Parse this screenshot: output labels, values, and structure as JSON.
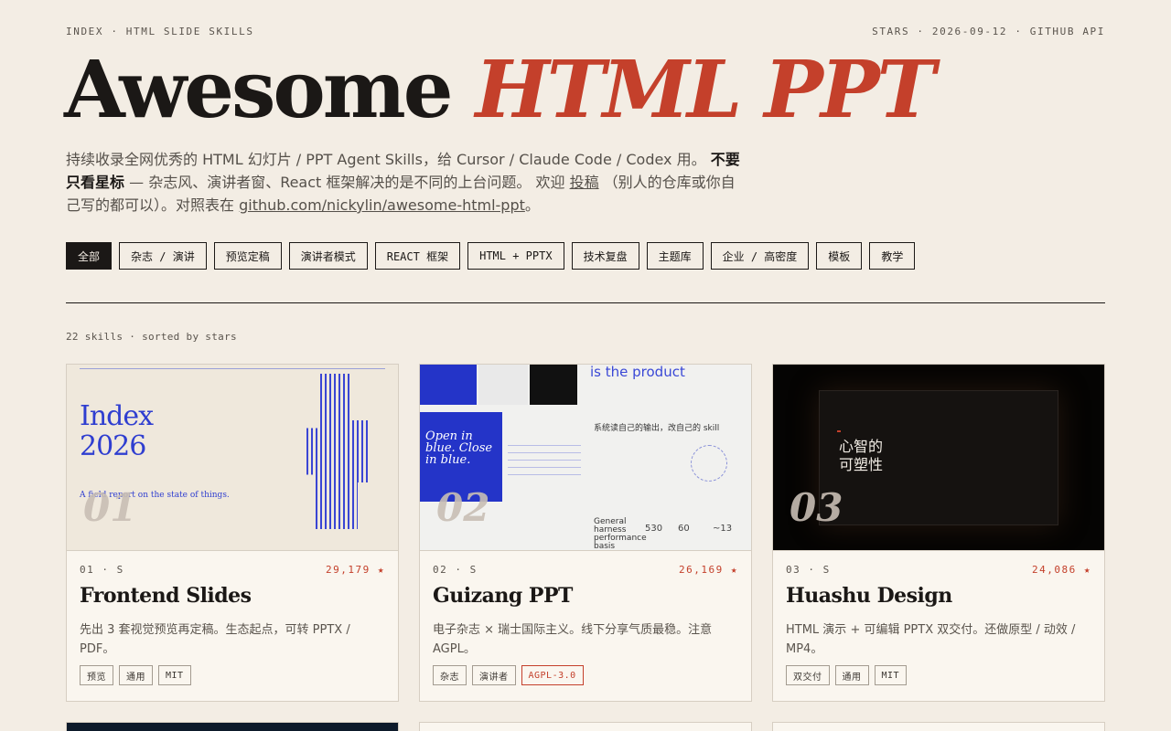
{
  "header": {
    "breadcrumb": "INDEX · HTML SLIDE SKILLS",
    "meta": "STARS · 2026-09-12 · GITHUB API",
    "title_main": "Awesome",
    "title_accent": "HTML PPT"
  },
  "intro": {
    "part1": "持续收录全网优秀的 HTML 幻灯片 / PPT Agent Skills，给 Cursor / Claude Code / Codex 用。",
    "bold": "不要只看星标",
    "part2": " — 杂志风、演讲者窗、React 框架解决的是不同的上台问题。 欢迎 ",
    "submit_link": "投稿",
    "part3": " （别人的仓库或你自己写的都可以）。对照表在 ",
    "repo_link": "github.com/nickylin/awesome-html-ppt",
    "part4": "。"
  },
  "filters": [
    {
      "label": "全部",
      "active": true
    },
    {
      "label": "杂志 / 演讲"
    },
    {
      "label": "预览定稿"
    },
    {
      "label": "演讲者模式"
    },
    {
      "label": "REACT 框架"
    },
    {
      "label": "HTML + PPTX"
    },
    {
      "label": "技术复盘"
    },
    {
      "label": "主题库"
    },
    {
      "label": "企业 / 高密度"
    },
    {
      "label": "模板"
    },
    {
      "label": "教学"
    }
  ],
  "count_text": "22 skills · sorted by stars",
  "cards": [
    {
      "num": "01",
      "meta": "01 · S",
      "stars": "29,179 ★",
      "title": "Frontend Slides",
      "desc": "先出 3 套视觉预览再定稿。生态起点，可转 PPTX / PDF。",
      "tags": [
        {
          "label": "预览"
        },
        {
          "label": "通用"
        },
        {
          "label": "MIT"
        }
      ],
      "thumb": {
        "heading_line1": "Index",
        "heading_line2": "2026",
        "subtitle": "A field report on the state of things."
      }
    },
    {
      "num": "02",
      "meta": "02 · S",
      "stars": "26,169 ★",
      "title": "Guizang PPT",
      "desc": "电子杂志 × 瑞士国际主义。线下分享气质最稳。注意 AGPL。",
      "tags": [
        {
          "label": "杂志"
        },
        {
          "label": "演讲者"
        },
        {
          "label": "AGPL-3.0",
          "warn": true
        }
      ],
      "thumb": {
        "headline": "is the product",
        "open_text": "Open in blue. Close in blue.",
        "cn_line": "系统读自己的输出，改自己的 skill",
        "stat1": "530",
        "stat2": "60",
        "stat3": "~13",
        "caption": "General harness performance basis"
      }
    },
    {
      "num": "03",
      "meta": "03 · S",
      "stars": "24,086 ★",
      "title": "Huashu Design",
      "desc": "HTML 演示 + 可编辑 PPTX 双交付。还做原型 / 动效 / MP4。",
      "tags": [
        {
          "label": "双交付"
        },
        {
          "label": "通用"
        },
        {
          "label": "MIT"
        }
      ],
      "thumb": {
        "cn_title_line1": "心智的",
        "cn_title_line2": "可塑性"
      }
    }
  ],
  "colors": {
    "accent": "#c4402b",
    "background": "#f3ede4",
    "ink": "#1b1816",
    "blue": "#2f3ed0"
  }
}
